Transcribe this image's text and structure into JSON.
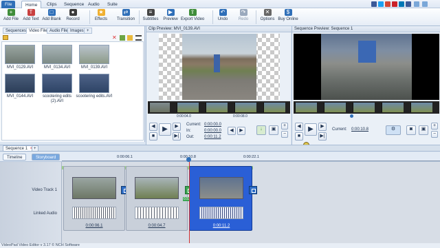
{
  "menu": {
    "tabs": [
      {
        "label": "File"
      },
      {
        "label": "Home"
      },
      {
        "label": "Clips"
      },
      {
        "label": "Sequence"
      },
      {
        "label": "Audio"
      },
      {
        "label": "Suite"
      }
    ]
  },
  "ribbon": {
    "buttons": [
      {
        "label": "Add File",
        "icon": "add-file-icon",
        "color": "#3f8d3a"
      },
      {
        "label": "Add Text",
        "icon": "add-text-icon",
        "color": "#c84040"
      },
      {
        "label": "Add Blank",
        "icon": "add-blank-icon",
        "color": "#2f6fb8"
      },
      {
        "label": "Record",
        "icon": "record-icon",
        "color": "#3b3b3b"
      },
      {
        "label": "Effects",
        "icon": "effects-icon",
        "color": "#f0b030"
      },
      {
        "label": "Transition",
        "icon": "transition-icon",
        "color": "#2f6fb8"
      },
      {
        "label": "Subtitles",
        "icon": "subtitles-icon",
        "color": "#444"
      },
      {
        "label": "Preview",
        "icon": "preview-icon",
        "color": "#2f6fb8"
      },
      {
        "label": "Export Video",
        "icon": "export-video-icon",
        "color": "#3f8d3a"
      },
      {
        "label": "Undo",
        "icon": "undo-icon",
        "color": "#2f6fb8"
      },
      {
        "label": "Redo",
        "icon": "redo-icon",
        "color": "#9aa9bd"
      },
      {
        "label": "Options",
        "icon": "options-icon",
        "color": "#666"
      },
      {
        "label": "Buy Online",
        "icon": "buy-online-icon",
        "color": "#2f6fb8"
      }
    ]
  },
  "bin": {
    "tabs": [
      {
        "label": "Sequences"
      },
      {
        "label": "Video Files"
      },
      {
        "label": "Audio Files"
      },
      {
        "label": "Images"
      },
      {
        "label": "+"
      }
    ],
    "files": [
      {
        "name": "MVI_0129.AVI"
      },
      {
        "name": "MVI_0134.AVI"
      },
      {
        "name": "MVI_0139.AVI"
      },
      {
        "name": "MVI_0144.AVI"
      },
      {
        "name": "scootering edits (2).AVI"
      },
      {
        "name": "scootering edits.AVI"
      }
    ]
  },
  "clip_preview": {
    "title": "Clip Preview: MVI_0139.AVI",
    "current_label": "Current:",
    "current_value": "0:00:00.0",
    "in_label": "In:",
    "in_value": "0:00:00.0",
    "out_label": "Out:",
    "out_value": "0:00:11.2",
    "ruler_marks": [
      "0:00:04.0",
      "0:00:08.0"
    ]
  },
  "sequence_preview": {
    "title": "Sequence Preview: Sequence 1",
    "current_label": "Current:",
    "current_value": "0:00:10.8"
  },
  "sequence": {
    "tab_label": "Sequence 1",
    "tab_add": "+",
    "view_tabs": [
      {
        "label": "Timeline"
      },
      {
        "label": "Storyboard"
      }
    ],
    "ruler_labels": [
      "0:00:06.1",
      "0:00:10.8",
      "0:00:22.1"
    ],
    "tracks": [
      {
        "label": "Video Track 1"
      },
      {
        "label": "Linked Audio"
      }
    ],
    "clips": [
      {
        "duration": "0:00:06.1",
        "selected": false
      },
      {
        "duration": "0:00:04.7",
        "selected": false
      },
      {
        "duration": "0:00:11.2",
        "selected": true
      }
    ],
    "transition_badge": "0.53"
  },
  "status": {
    "text": "VideoPad Video Editor v 3.17 © NCH Software"
  },
  "colors": {
    "accent": "#2f6fb8",
    "selected_clip": "#2a5fd6",
    "playhead": "#d23030"
  }
}
